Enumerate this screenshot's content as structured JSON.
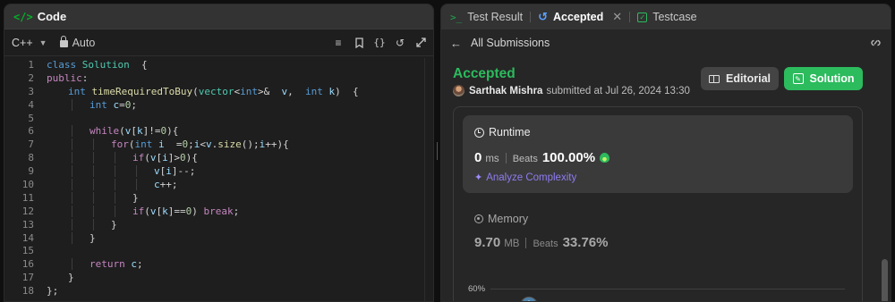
{
  "left_panel": {
    "title": "Code",
    "icon": "code-icon",
    "language": "C++",
    "mode": "Auto",
    "tool_icons": [
      "format-icon",
      "bookmark-icon",
      "braces-icon",
      "undo-icon",
      "expand-icon"
    ]
  },
  "code": {
    "lines": [
      {
        "n": "1",
        "indent": 0,
        "parts": [
          [
            "kw2",
            "class "
          ],
          [
            "ty",
            "Solution"
          ],
          [
            "",
            "  {"
          ]
        ]
      },
      {
        "n": "2",
        "indent": 0,
        "parts": [
          [
            "kw",
            "public"
          ],
          [
            "",
            ":"
          ]
        ]
      },
      {
        "n": "3",
        "indent": 1,
        "parts": [
          [
            "kw2",
            "int "
          ],
          [
            "fn",
            "timeRequiredToBuy"
          ],
          [
            "",
            "("
          ],
          [
            "ty",
            "vector"
          ],
          [
            "",
            "<"
          ],
          [
            "kw2",
            "int"
          ],
          [
            "",
            ">&  "
          ],
          [
            "var",
            "v"
          ],
          [
            "",
            ",  "
          ],
          [
            "kw2",
            "int "
          ],
          [
            "var",
            "k"
          ],
          [
            "",
            ")  {"
          ]
        ]
      },
      {
        "n": "4",
        "indent": 2,
        "parts": [
          [
            "kw2",
            "int "
          ],
          [
            "var",
            "c"
          ],
          [
            "",
            "="
          ],
          [
            "num",
            "0"
          ],
          [
            "",
            ";"
          ]
        ]
      },
      {
        "n": "5",
        "indent": 0,
        "parts": []
      },
      {
        "n": "6",
        "indent": 2,
        "parts": [
          [
            "kw",
            "while"
          ],
          [
            "",
            "("
          ],
          [
            "var",
            "v"
          ],
          [
            "",
            "["
          ],
          [
            "var",
            "k"
          ],
          [
            "",
            "]!="
          ],
          [
            "num",
            "0"
          ],
          [
            "",
            "){"
          ]
        ]
      },
      {
        "n": "7",
        "indent": 3,
        "parts": [
          [
            "kw",
            "for"
          ],
          [
            "",
            "("
          ],
          [
            "kw2",
            "int "
          ],
          [
            "var",
            "i"
          ],
          [
            "",
            "  ="
          ],
          [
            "num",
            "0"
          ],
          [
            "",
            ";"
          ],
          [
            "var",
            "i"
          ],
          [
            "",
            "<"
          ],
          [
            "var",
            "v"
          ],
          [
            "",
            "."
          ],
          [
            "fn",
            "size"
          ],
          [
            "",
            "();"
          ],
          [
            "var",
            "i"
          ],
          [
            "",
            "++){"
          ]
        ]
      },
      {
        "n": "8",
        "indent": 4,
        "parts": [
          [
            "kw",
            "if"
          ],
          [
            "",
            "("
          ],
          [
            "var",
            "v"
          ],
          [
            "",
            "["
          ],
          [
            "var",
            "i"
          ],
          [
            "",
            "]>"
          ],
          [
            "num",
            "0"
          ],
          [
            "",
            "){"
          ]
        ]
      },
      {
        "n": "9",
        "indent": 5,
        "parts": [
          [
            "var",
            "v"
          ],
          [
            "",
            "["
          ],
          [
            "var",
            "i"
          ],
          [
            "",
            "]--;"
          ]
        ]
      },
      {
        "n": "10",
        "indent": 5,
        "parts": [
          [
            "var",
            "c"
          ],
          [
            "",
            "++;"
          ]
        ]
      },
      {
        "n": "11",
        "indent": 4,
        "parts": [
          [
            "",
            "}"
          ]
        ]
      },
      {
        "n": "12",
        "indent": 4,
        "parts": [
          [
            "kw",
            "if"
          ],
          [
            "",
            "("
          ],
          [
            "var",
            "v"
          ],
          [
            "",
            "["
          ],
          [
            "var",
            "k"
          ],
          [
            "",
            "]=="
          ],
          [
            "num",
            "0"
          ],
          [
            "",
            ") "
          ],
          [
            "kw",
            "break"
          ],
          [
            "",
            ";"
          ]
        ]
      },
      {
        "n": "13",
        "indent": 3,
        "parts": [
          [
            "",
            "}"
          ]
        ]
      },
      {
        "n": "14",
        "indent": 2,
        "parts": [
          [
            "",
            "}"
          ]
        ]
      },
      {
        "n": "15",
        "indent": 0,
        "parts": []
      },
      {
        "n": "16",
        "indent": 2,
        "parts": [
          [
            "kw",
            "return "
          ],
          [
            "var",
            "c"
          ],
          [
            "",
            ";"
          ]
        ]
      },
      {
        "n": "17",
        "indent": 1,
        "parts": [
          [
            "",
            "}"
          ]
        ]
      },
      {
        "n": "18",
        "indent": 0,
        "parts": [
          [
            "",
            "};"
          ]
        ]
      }
    ]
  },
  "right_panel": {
    "tabs": [
      {
        "label": "Test Result",
        "icon": "terminal-icon"
      },
      {
        "label": "Accepted",
        "icon": "history-icon",
        "active": true
      },
      {
        "label": "Testcase",
        "icon": "checkbox-icon"
      }
    ],
    "back_label": "All Submissions",
    "verdict": "Accepted",
    "author": "Sarthak Mishra",
    "submitted_text": "submitted at Jul 26, 2024 13:30",
    "editorial_label": "Editorial",
    "solution_label": "Solution",
    "runtime": {
      "title": "Runtime",
      "value": "0",
      "unit": "ms",
      "beats_label": "Beats",
      "beats": "100.00%",
      "analyze_label": "Analyze Complexity"
    },
    "memory": {
      "title": "Memory",
      "value": "9.70",
      "unit": "MB",
      "beats_label": "Beats",
      "beats": "33.76%"
    },
    "chart_tick": "60%"
  },
  "colors": {
    "accent_green": "#2cbb5d",
    "analyze_purple": "#8e7cf0",
    "history_blue": "#5aa0ff"
  }
}
